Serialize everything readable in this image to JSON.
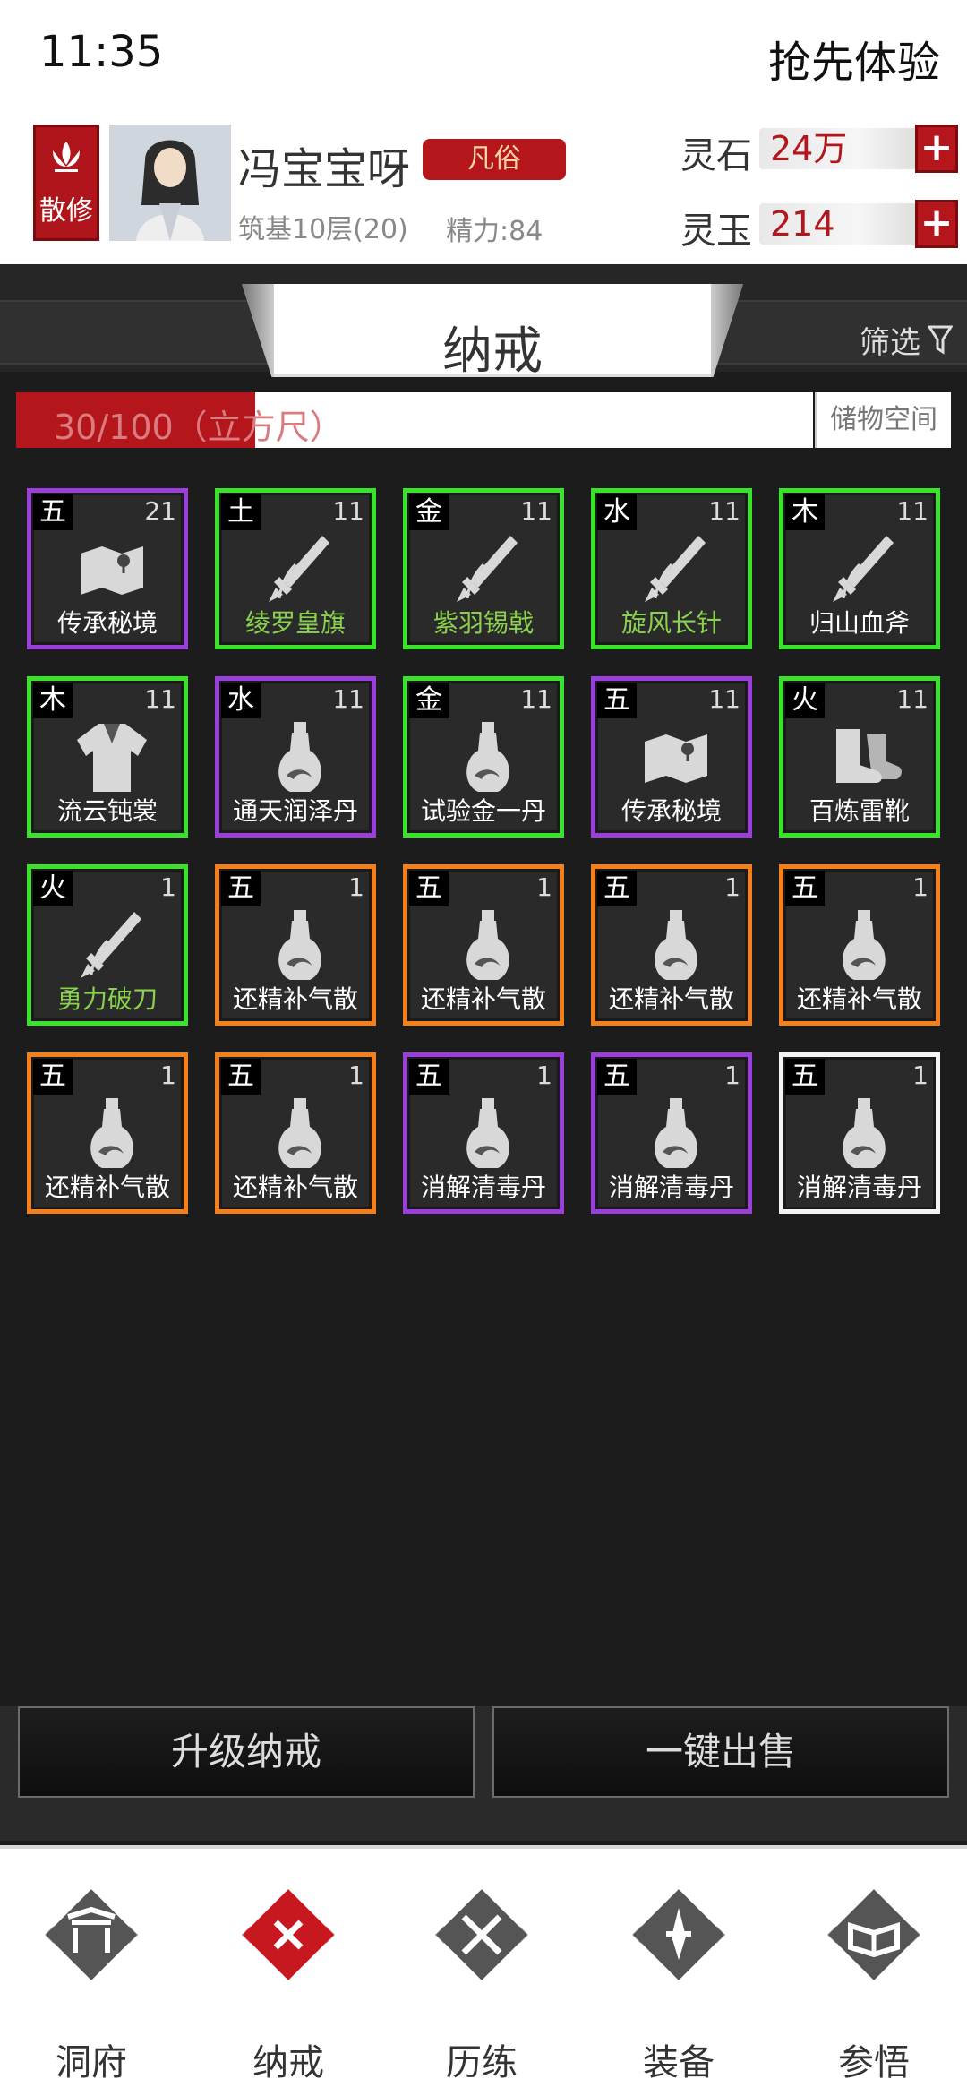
{
  "status_bar": {
    "time": "11:35",
    "preview": "抢先体验"
  },
  "player": {
    "sect_label": "散修",
    "name": "冯宝宝呀",
    "realm": "凡俗",
    "cultivation": "筑基10层(20)",
    "stamina": "精力:84"
  },
  "resources": {
    "stone": {
      "label": "灵石",
      "value": "24万"
    },
    "jade": {
      "label": "灵玉",
      "value": "214"
    }
  },
  "tab": {
    "title": "纳戒",
    "filter_label": "筛选"
  },
  "capacity": {
    "text": "30/100（立方尺）",
    "used": 30,
    "total": 100,
    "storage_label": "储物空间"
  },
  "items": [
    {
      "element": "五",
      "count": "21",
      "name": "传承秘境",
      "quality": "purple",
      "icon": "scroll-map-icon"
    },
    {
      "element": "土",
      "count": "11",
      "name": "绫罗皇旗",
      "quality": "green",
      "icon": "weapon-icon",
      "name_color": "green"
    },
    {
      "element": "金",
      "count": "11",
      "name": "紫羽锡戟",
      "quality": "green",
      "icon": "weapon-icon",
      "name_color": "green"
    },
    {
      "element": "水",
      "count": "11",
      "name": "旋风长针",
      "quality": "green",
      "icon": "weapon-icon",
      "name_color": "green"
    },
    {
      "element": "木",
      "count": "11",
      "name": "归山血斧",
      "quality": "green",
      "icon": "weapon-icon"
    },
    {
      "element": "木",
      "count": "11",
      "name": "流云钝裳",
      "quality": "green",
      "icon": "robe-icon"
    },
    {
      "element": "水",
      "count": "11",
      "name": "通天润泽丹",
      "quality": "purple",
      "icon": "potion-gourd-icon"
    },
    {
      "element": "金",
      "count": "11",
      "name": "试验金一丹",
      "quality": "green",
      "icon": "potion-gourd-icon"
    },
    {
      "element": "五",
      "count": "11",
      "name": "传承秘境",
      "quality": "purple",
      "icon": "scroll-map-icon"
    },
    {
      "element": "火",
      "count": "11",
      "name": "百炼雷靴",
      "quality": "green",
      "icon": "boots-icon"
    },
    {
      "element": "火",
      "count": "1",
      "name": "勇力破刀",
      "quality": "green",
      "icon": "weapon-icon",
      "name_color": "green"
    },
    {
      "element": "五",
      "count": "1",
      "name": "还精补气散",
      "quality": "orange",
      "icon": "potion-gourd-icon"
    },
    {
      "element": "五",
      "count": "1",
      "name": "还精补气散",
      "quality": "orange",
      "icon": "potion-gourd-icon"
    },
    {
      "element": "五",
      "count": "1",
      "name": "还精补气散",
      "quality": "orange",
      "icon": "potion-gourd-icon"
    },
    {
      "element": "五",
      "count": "1",
      "name": "还精补气散",
      "quality": "orange",
      "icon": "potion-gourd-icon"
    },
    {
      "element": "五",
      "count": "1",
      "name": "还精补气散",
      "quality": "orange",
      "icon": "potion-gourd-icon"
    },
    {
      "element": "五",
      "count": "1",
      "name": "还精补气散",
      "quality": "orange",
      "icon": "potion-gourd-icon"
    },
    {
      "element": "五",
      "count": "1",
      "name": "消解清毒丹",
      "quality": "purple",
      "icon": "potion-gourd-icon"
    },
    {
      "element": "五",
      "count": "1",
      "name": "消解清毒丹",
      "quality": "purple",
      "icon": "potion-gourd-icon"
    },
    {
      "element": "五",
      "count": "1",
      "name": "消解清毒丹",
      "quality": "white",
      "icon": "potion-gourd-icon"
    }
  ],
  "actions": {
    "upgrade": "升级纳戒",
    "sell_all": "一键出售"
  },
  "nav": [
    {
      "label": "洞府",
      "icon": "gate-icon",
      "active": false
    },
    {
      "label": "纳戒",
      "icon": "close-x-icon",
      "active": true
    },
    {
      "label": "历练",
      "icon": "crossed-swords-icon",
      "active": false
    },
    {
      "label": "装备",
      "icon": "dagger-icon",
      "active": false
    },
    {
      "label": "参悟",
      "icon": "book-icon",
      "active": false
    }
  ],
  "colors": {
    "accent_red": "#b5161c",
    "green_quality": "#3ae22b",
    "purple_quality": "#9a3fd9",
    "orange_quality": "#f3801b",
    "white_quality": "#f4f4f4",
    "background": "#1c1c1c"
  }
}
